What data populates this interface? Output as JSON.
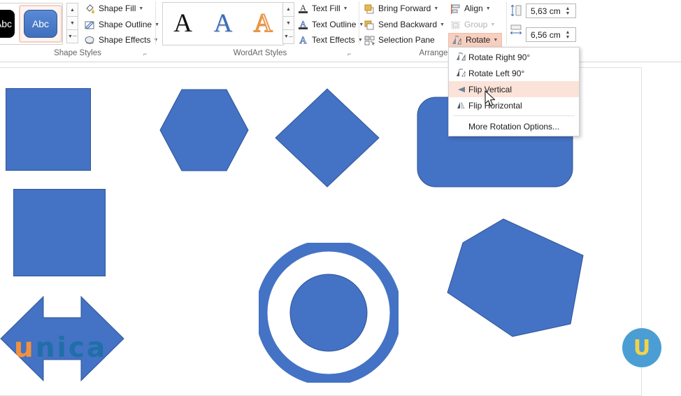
{
  "ribbon": {
    "groups": [
      {
        "label": "Shape Styles"
      },
      {
        "label": "WordArt Styles"
      },
      {
        "label": "Arrange"
      }
    ],
    "shape_styles": {
      "preview_dark_label": "Abc",
      "preview_selected_label": "Abc",
      "commands": [
        {
          "name": "shape-fill",
          "label": "Shape Fill",
          "icon": "paint-bucket-icon",
          "has_arrow": true
        },
        {
          "name": "shape-outline",
          "label": "Shape Outline",
          "icon": "pencil-outline-icon",
          "has_arrow": true
        },
        {
          "name": "shape-effects",
          "label": "Shape Effects",
          "icon": "effects-icon",
          "has_arrow": true
        }
      ]
    },
    "wordart_styles": {
      "previews": [
        "A",
        "A",
        "A"
      ],
      "commands": [
        {
          "name": "text-fill",
          "label": "Text Fill",
          "icon": "text-fill-icon",
          "has_arrow": true
        },
        {
          "name": "text-outline",
          "label": "Text Outline",
          "icon": "text-outline-icon",
          "has_arrow": true
        },
        {
          "name": "text-effects",
          "label": "Text Effects",
          "icon": "text-effects-icon",
          "has_arrow": true
        }
      ]
    },
    "arrange": {
      "commands": [
        {
          "name": "bring-forward",
          "label": "Bring Forward",
          "icon": "bring-forward-icon",
          "has_arrow": true,
          "disabled": false
        },
        {
          "name": "send-backward",
          "label": "Send Backward",
          "icon": "send-backward-icon",
          "has_arrow": true,
          "disabled": false
        },
        {
          "name": "selection-pane",
          "label": "Selection Pane",
          "icon": "selection-pane-icon",
          "has_arrow": false,
          "disabled": false
        },
        {
          "name": "align",
          "label": "Align",
          "icon": "align-icon",
          "has_arrow": true,
          "disabled": false
        },
        {
          "name": "group",
          "label": "Group",
          "icon": "group-icon",
          "has_arrow": true,
          "disabled": true
        },
        {
          "name": "rotate",
          "label": "Rotate",
          "icon": "rotate-icon",
          "has_arrow": true,
          "disabled": false
        }
      ]
    },
    "size": {
      "height": {
        "name": "shape-height",
        "value": "5,63 cm",
        "icon": "height-icon"
      },
      "width": {
        "name": "shape-width",
        "value": "6,56 cm",
        "icon": "width-icon"
      }
    }
  },
  "rotate_menu": {
    "items": [
      {
        "name": "rotate-right-90",
        "label": "Rotate Right 90°",
        "icon": "rotate-right-icon",
        "highlighted": false
      },
      {
        "name": "rotate-left-90",
        "label": "Rotate Left 90°",
        "icon": "rotate-left-icon",
        "highlighted": false
      },
      {
        "name": "flip-vertical",
        "label": "Flip Vertical",
        "icon": "flip-vertical-icon",
        "highlighted": true
      },
      {
        "name": "flip-horizontal",
        "label": "Flip Horizontal",
        "icon": "flip-horizontal-icon",
        "highlighted": false
      }
    ],
    "more_options": {
      "name": "more-rotation-options",
      "label": "More Rotation Options..."
    }
  },
  "canvas": {
    "shape_color": "#4472c4",
    "shape_outline_color": "#2f5597",
    "shapes": [
      {
        "name": "rectangle-shape",
        "type": "rectangle"
      },
      {
        "name": "hexagon-shape",
        "type": "hexagon"
      },
      {
        "name": "diamond-shape",
        "type": "diamond"
      },
      {
        "name": "rounded-rectangle-shape",
        "type": "rounded-rectangle"
      },
      {
        "name": "square-shape",
        "type": "rectangle"
      },
      {
        "name": "donut-shape",
        "type": "donut"
      },
      {
        "name": "circle-shape",
        "type": "circle"
      },
      {
        "name": "pentagon-shape",
        "type": "pentagon"
      },
      {
        "name": "left-right-arrow-shape",
        "type": "left-right-arrow"
      }
    ]
  },
  "watermarks": {
    "brand_first_letter": "u",
    "brand_rest": "nica",
    "badge_letter": "U",
    "brand_first_color": "#f2913d",
    "brand_rest_color": "#1f6fa8",
    "badge_bg_color": "#4a9ed4",
    "badge_letter_color": "#f2d24b"
  }
}
